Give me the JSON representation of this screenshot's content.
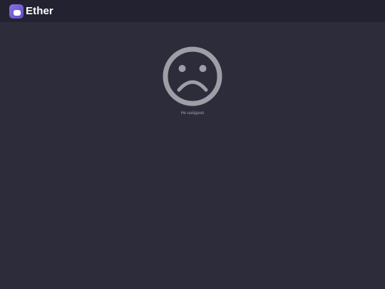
{
  "header": {
    "app_name": "Ether",
    "logo_icon": "ether-logo-icon"
  },
  "main": {
    "icon": "sad-face-icon",
    "message": "Не найдено"
  },
  "colors": {
    "background": "#2c2c3b",
    "header_background": "#222230",
    "face_color": "#9e9ea6",
    "brand_gradient_start": "#8e6fe0",
    "brand_gradient_end": "#5b4fc4"
  }
}
